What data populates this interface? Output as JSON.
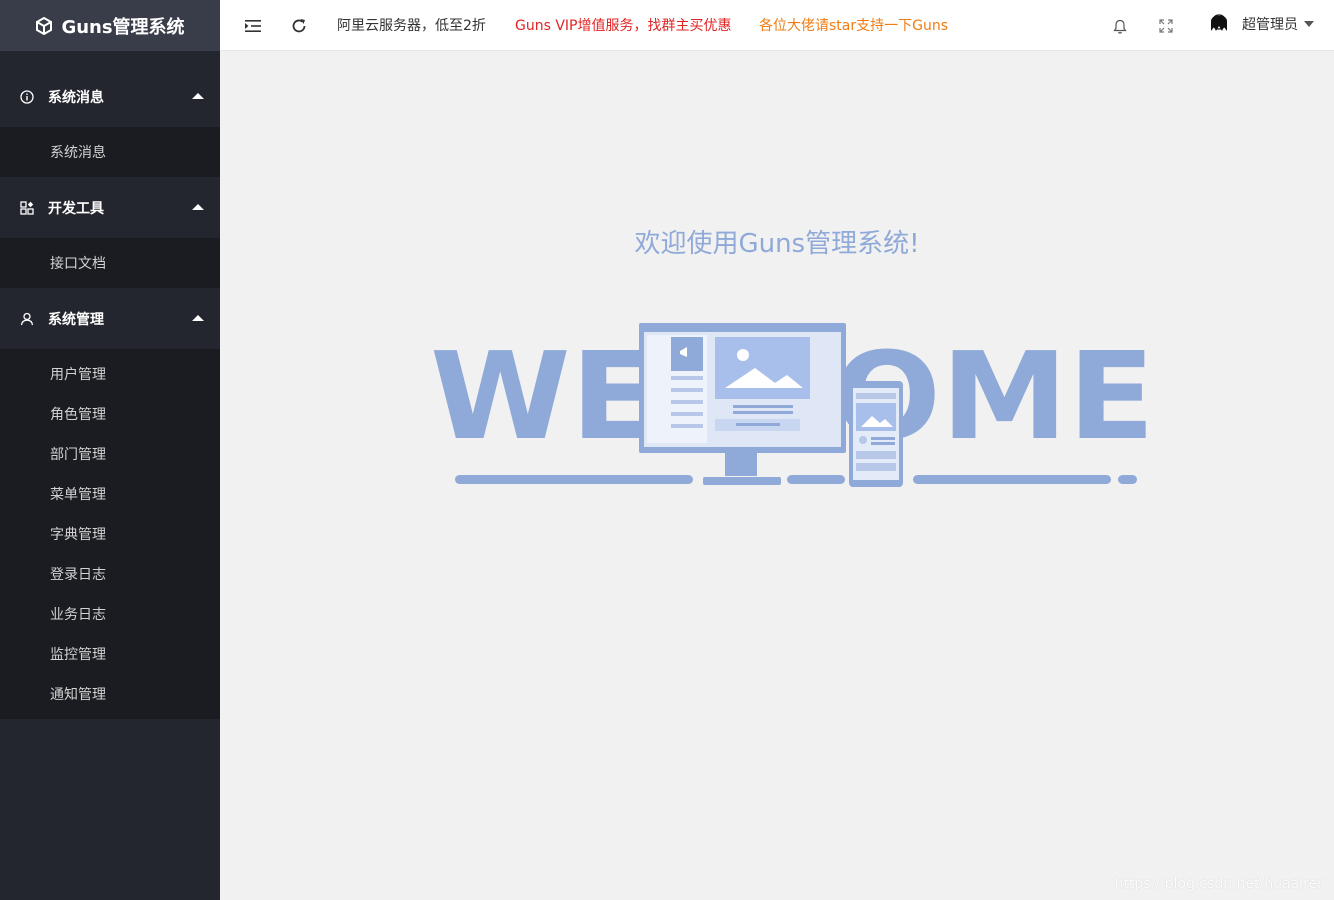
{
  "app": {
    "title": "Guns管理系统"
  },
  "sidebar": {
    "groups": [
      {
        "label": "系统消息",
        "icon": "info-icon",
        "items": [
          "系统消息"
        ]
      },
      {
        "label": "开发工具",
        "icon": "apps-icon",
        "items": [
          "接口文档"
        ]
      },
      {
        "label": "系统管理",
        "icon": "user-icon",
        "items": [
          "用户管理",
          "角色管理",
          "部门管理",
          "菜单管理",
          "字典管理",
          "登录日志",
          "业务日志",
          "监控管理",
          "通知管理"
        ]
      }
    ]
  },
  "header": {
    "links": [
      {
        "text": "阿里云服务器，低至2折",
        "color": "#333333"
      },
      {
        "text": "Guns VIP增值服务，找群主买优惠",
        "color": "#e02424"
      },
      {
        "text": "各位大佬请star支持一下Guns",
        "color": "#f07d13"
      }
    ],
    "user": {
      "name": "超管理员"
    },
    "icons": [
      "menu-fold-icon",
      "refresh-icon",
      "bell-icon",
      "fullscreen-icon"
    ]
  },
  "main": {
    "welcome_text": "欢迎使用Guns管理系统!",
    "banner_text": "WELCOME",
    "accent_color": "#8fa9d8"
  },
  "watermark": "https://blog.csdn.net/huaairen"
}
